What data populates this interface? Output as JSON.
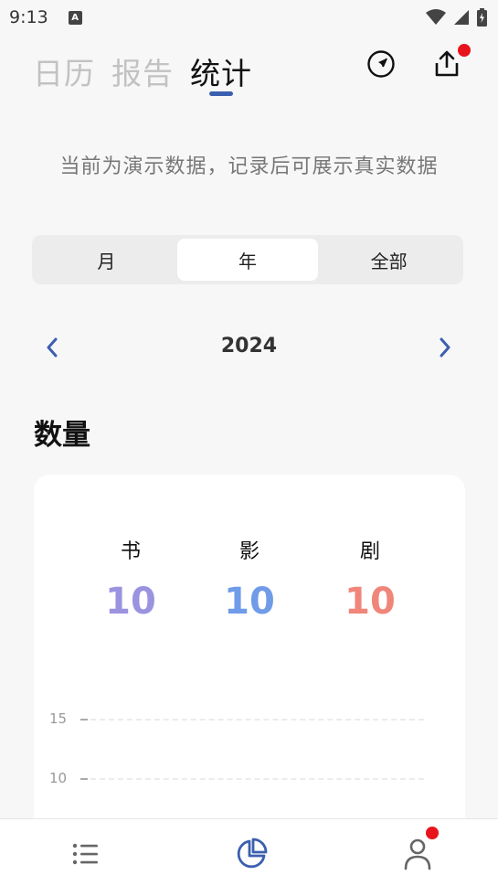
{
  "status": {
    "time": "9:13",
    "a_badge": "A"
  },
  "tabs": [
    {
      "label": "日历"
    },
    {
      "label": "报告"
    },
    {
      "label": "统计"
    }
  ],
  "icons": {
    "compass": "compass-icon",
    "share": "share-icon"
  },
  "demo_note": "当前为演示数据，记录后可展示真实数据",
  "segments": [
    {
      "label": "月"
    },
    {
      "label": "年"
    },
    {
      "label": "全部"
    }
  ],
  "year": "2024",
  "section_title": "数量",
  "counts": [
    {
      "label": "书",
      "value": "10",
      "color": "#9b93e0"
    },
    {
      "label": "影",
      "value": "10",
      "color": "#6f9be8"
    },
    {
      "label": "剧",
      "value": "10",
      "color": "#f0867a"
    }
  ],
  "chart_data": {
    "type": "bar",
    "categories": [],
    "values": [],
    "yticks": [
      "15",
      "10"
    ]
  },
  "colors": {
    "accent": "#3b5fb0",
    "notification": "#e8141b"
  }
}
